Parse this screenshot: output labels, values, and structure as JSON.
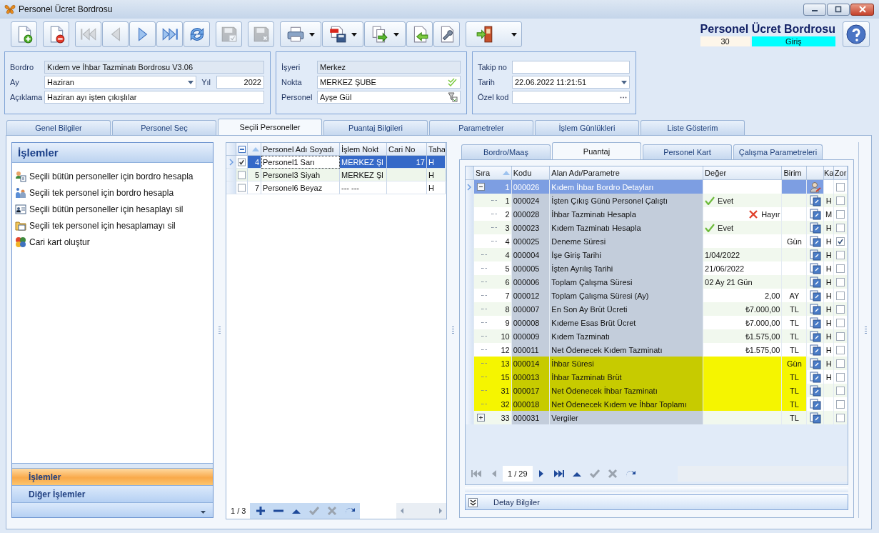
{
  "window": {
    "title": "Personel Ücret Bordrosu"
  },
  "toolbar": [
    [
      {
        "kind": "new",
        "disabled": false,
        "dropdown": false
      }
    ],
    [
      {
        "kind": "delete",
        "disabled": false,
        "dropdown": false
      }
    ],
    [
      {
        "kind": "first",
        "disabled": true,
        "dropdown": false
      },
      {
        "kind": "prev",
        "disabled": true,
        "dropdown": false
      },
      {
        "kind": "next",
        "disabled": false,
        "dropdown": false
      },
      {
        "kind": "last",
        "disabled": false,
        "dropdown": false
      },
      {
        "kind": "refresh",
        "disabled": false,
        "dropdown": false
      }
    ],
    [
      {
        "kind": "save",
        "disabled": true,
        "dropdown": false
      }
    ],
    [
      {
        "kind": "discard",
        "disabled": true,
        "dropdown": false
      }
    ],
    [
      {
        "kind": "print",
        "disabled": false,
        "dropdown": true
      },
      {
        "kind": "pdf",
        "disabled": false,
        "dropdown": true
      },
      {
        "kind": "export",
        "disabled": false,
        "dropdown": true
      },
      {
        "kind": "import",
        "disabled": false,
        "dropdown": false
      },
      {
        "kind": "settings",
        "disabled": false,
        "dropdown": false
      }
    ],
    [
      {
        "kind": "exit",
        "disabled": false,
        "dropdown": true
      }
    ]
  ],
  "header": {
    "title": "Personel Ücret Bordrosu",
    "count": "30",
    "mode": "Giriş"
  },
  "form_groups": [
    {
      "rows": [
        [
          {
            "label": "Bordro",
            "value": "Kıdem ve İhbar Tazminatı Bordrosu V3.06",
            "kind": "readonly"
          }
        ],
        [
          {
            "label": "Ay",
            "value": "Haziran",
            "kind": "combo"
          },
          {
            "label": "Yıl",
            "value": "2022",
            "kind": "number"
          }
        ],
        [
          {
            "label": "Açıklama",
            "value": "Haziran ayı işten çıkışlılar",
            "kind": "text"
          }
        ]
      ]
    },
    {
      "rows": [
        [
          {
            "label": "İşyeri",
            "value": "Merkez",
            "kind": "readonly"
          }
        ],
        [
          {
            "label": "Nokta",
            "value": "MERKEZ ŞUBE",
            "kind": "check"
          }
        ],
        [
          {
            "label": "Personel",
            "value": "Ayşe Gül",
            "kind": "lookup"
          }
        ]
      ]
    },
    {
      "rows": [
        [
          {
            "label": "Takip no",
            "kind": "text"
          }
        ],
        [
          {
            "label": "Tarih",
            "value": "22.06.2022 11:21:51",
            "kind": "combo"
          }
        ],
        [
          {
            "label": "Özel kod",
            "kind": "ellipsis"
          }
        ]
      ]
    }
  ],
  "tabs": [
    {
      "label": "Genel Bilgiler",
      "selected": false
    },
    {
      "label": "Personel Seç",
      "selected": false
    },
    {
      "label": "Seçili Personeller",
      "selected": true
    },
    {
      "label": "Puantaj Bilgileri",
      "selected": false
    },
    {
      "label": "Parametreler",
      "selected": false
    },
    {
      "label": "İşlem Günlükleri",
      "selected": false
    },
    {
      "label": "Liste Gösterim",
      "selected": false
    }
  ],
  "actions_panel": {
    "title": "İşlemler",
    "items": [
      {
        "label": "Seçili bütün personeller için bordro hesapla",
        "kind": "users"
      },
      {
        "label": "Seçili tek personel için bordro hesapla",
        "kind": "user"
      },
      {
        "label": "Seçili bütün personeller için hesaplayı sil",
        "kind": "card"
      },
      {
        "label": "Seçili tek personel için hesaplamayı sil",
        "kind": "folder"
      },
      {
        "label": "Cari kart oluştur",
        "kind": "coins"
      }
    ],
    "bars": [
      {
        "label": "İşlemler",
        "selected": true
      },
      {
        "label": "Diğer İşlemler",
        "selected": false
      }
    ]
  },
  "personnel_grid": {
    "columns": [
      "Personel Adı Soyadı",
      "İşlem Nokt",
      "Cari No",
      "Taha"
    ],
    "rows": [
      {
        "no": "4",
        "name": "Personel1 Sarı",
        "point": "MERKEZ Şl",
        "cari": "17",
        "taha": "H",
        "checked": true,
        "selected": true
      },
      {
        "no": "5",
        "name": "Personel3 Siyah",
        "point": "MERKEZ Şl",
        "taha": "H",
        "checked": false,
        "selected": false
      },
      {
        "no": "7",
        "name": "Personel6 Beyaz",
        "point": "--- ---",
        "taha": "H",
        "checked": false,
        "selected": false
      }
    ],
    "pager": {
      "counter": "1 / 3",
      "buttons": [
        {
          "kind": "add",
          "disabled": false
        },
        {
          "kind": "remove",
          "disabled": false
        },
        {
          "kind": "up",
          "disabled": false
        },
        {
          "kind": "check",
          "disabled": true
        },
        {
          "kind": "cancel",
          "disabled": true
        },
        {
          "kind": "redo",
          "disabled": false
        }
      ]
    }
  },
  "puantaj": {
    "tabs": [
      {
        "label": "Bordro/Maaş",
        "selected": false
      },
      {
        "label": "Puantaj",
        "selected": true
      },
      {
        "label": "Personel Kart",
        "selected": false
      },
      {
        "label": "Çalışma Parametreleri",
        "selected": false
      }
    ],
    "columns": [
      "Sıra",
      "Kodu",
      "Alan Adı/Parametre",
      "Değer",
      "Birim",
      "Ka",
      "Zor"
    ],
    "rows": [
      {
        "kind": "group",
        "expanded": true,
        "sira": "1",
        "kodu": "000026",
        "name": "Kıdem İhbar Bordro Detayları",
        "icon": {
          "kind": "person"
        },
        "zor": false,
        "selected": true,
        "highlighted": false,
        "children": [
          {
            "sira": "1",
            "kodu": "000024",
            "name": "İşten Çıkış Günü Personel Çalıştı",
            "value": {
              "kind": "yes",
              "text": "Evet"
            },
            "icon": {
              "kind": "document"
            },
            "ka": "H",
            "zor": false,
            "selected": false,
            "highlighted": false
          },
          {
            "sira": "2",
            "kodu": "000028",
            "name": "İhbar Tazminatı Hesapla",
            "value": {
              "kind": "no",
              "text": "Hayır"
            },
            "icon": {
              "kind": "document"
            },
            "ka": "M",
            "zor": false,
            "selected": false,
            "highlighted": false
          },
          {
            "sira": "3",
            "kodu": "000023",
            "name": "Kıdem Tazminatı Hesapla",
            "value": {
              "kind": "yes",
              "text": "Evet"
            },
            "icon": {
              "kind": "document"
            },
            "ka": "H",
            "zor": false,
            "selected": false,
            "highlighted": false
          },
          {
            "sira": "4",
            "kodu": "000025",
            "name": "Deneme Süresi",
            "unit": "Gün",
            "icon": {
              "kind": "document"
            },
            "ka": "H",
            "zor": true,
            "selected": false,
            "highlighted": false
          }
        ]
      },
      {
        "sira": "4",
        "kodu": "000004",
        "name": "İşe Giriş Tarihi",
        "value": {
          "kind": "text",
          "text": "1/04/2022"
        },
        "icon": {
          "kind": "document"
        },
        "ka": "H",
        "zor": false,
        "selected": false,
        "highlighted": false
      },
      {
        "sira": "5",
        "kodu": "000005",
        "name": "İşten Ayrılış Tarihi",
        "value": {
          "kind": "text",
          "text": "21/06/2022"
        },
        "icon": {
          "kind": "document"
        },
        "ka": "H",
        "zor": false,
        "selected": false,
        "highlighted": false
      },
      {
        "sira": "6",
        "kodu": "000006",
        "name": "Toplam Çalışma Süresi",
        "value": {
          "kind": "text",
          "text": "02 Ay 21 Gün"
        },
        "icon": {
          "kind": "document"
        },
        "ka": "H",
        "zor": false,
        "selected": false,
        "highlighted": false
      },
      {
        "sira": "7",
        "kodu": "000012",
        "name": "Toplam Çalışma Süresi (Ay)",
        "value": {
          "kind": "amount",
          "text": "2,00"
        },
        "unit": "AY",
        "icon": {
          "kind": "document"
        },
        "ka": "H",
        "zor": false,
        "selected": false,
        "highlighted": false
      },
      {
        "sira": "8",
        "kodu": "000007",
        "name": "En Son Ay Brüt Ücreti",
        "value": {
          "kind": "amount",
          "text": "₺7.000,00"
        },
        "unit": "TL",
        "icon": {
          "kind": "document"
        },
        "ka": "H",
        "zor": false,
        "selected": false,
        "highlighted": false
      },
      {
        "sira": "9",
        "kodu": "000008",
        "name": "Kıdeme Esas Brüt Ücret",
        "value": {
          "kind": "amount",
          "text": "₺7.000,00"
        },
        "unit": "TL",
        "icon": {
          "kind": "document"
        },
        "ka": "H",
        "zor": false,
        "selected": false,
        "highlighted": false
      },
      {
        "sira": "10",
        "kodu": "000009",
        "name": "Kıdem Tazminatı",
        "value": {
          "kind": "amount",
          "text": "₺1.575,00"
        },
        "unit": "TL",
        "icon": {
          "kind": "document"
        },
        "ka": "H",
        "zor": false,
        "selected": false,
        "highlighted": false
      },
      {
        "sira": "12",
        "kodu": "000011",
        "name": "Net Ödenecek Kıdem Tazminatı",
        "value": {
          "kind": "amount",
          "text": "₺1.575,00"
        },
        "unit": "TL",
        "icon": {
          "kind": "document"
        },
        "ka": "H",
        "zor": false,
        "selected": false,
        "highlighted": false
      },
      {
        "sira": "13",
        "kodu": "000014",
        "name": "İhbar Süresi",
        "unit": "Gün",
        "icon": {
          "kind": "document"
        },
        "ka": "H",
        "zor": false,
        "selected": false,
        "highlighted": true
      },
      {
        "sira": "15",
        "kodu": "000013",
        "name": "İhbar Tazminatı Brüt",
        "unit": "TL",
        "icon": {
          "kind": "document"
        },
        "ka": "H",
        "zor": false,
        "selected": false,
        "highlighted": true
      },
      {
        "sira": "31",
        "kodu": "000017",
        "name": "Net Ödenecek İhbar Tazminatı",
        "unit": "TL",
        "icon": {
          "kind": "document"
        },
        "zor": false,
        "selected": false,
        "highlighted": true
      },
      {
        "sira": "32",
        "kodu": "000018",
        "name": "Net Ödenecek Kıdem ve İhbar Toplamı",
        "unit": "TL",
        "icon": {
          "kind": "document"
        },
        "zor": false,
        "selected": false,
        "highlighted": true
      },
      {
        "kind": "group",
        "expanded": false,
        "sira": "33",
        "kodu": "000031",
        "name": "Vergiler",
        "unit": "TL",
        "icon": {
          "kind": "document"
        },
        "zor": false,
        "selected": false,
        "highlighted": false
      }
    ],
    "pager": {
      "counter": "1 / 29",
      "buttons": [
        {
          "kind": "first",
          "disabled": true
        },
        {
          "kind": "prev",
          "disabled": true
        },
        {
          "kind": "next",
          "disabled": false
        },
        {
          "kind": "last",
          "disabled": false
        },
        {
          "kind": "up",
          "disabled": false
        },
        {
          "kind": "check",
          "disabled": true
        },
        {
          "kind": "cancel",
          "disabled": true
        },
        {
          "kind": "redo",
          "disabled": false
        }
      ]
    },
    "detail_bar": {
      "label": "Detay Bilgiler"
    }
  }
}
